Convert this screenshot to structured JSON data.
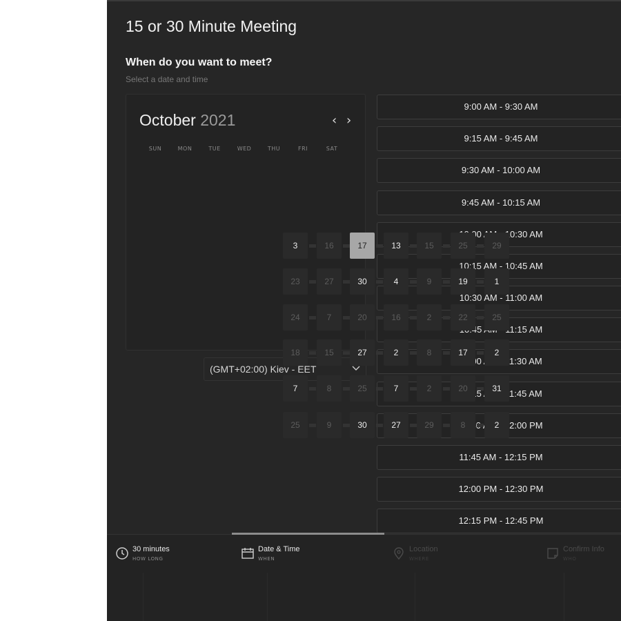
{
  "meeting": {
    "title": "15 or 30 Minute Meeting",
    "question": "When do you want to meet?",
    "hint": "Select a date and time"
  },
  "calendar": {
    "month": "October",
    "year": "2021",
    "prev_icon": "chevron-left-icon",
    "next_icon": "chevron-right-icon",
    "prev_glyph": "‹",
    "next_glyph": "›",
    "weekdays": [
      "SUN",
      "MON",
      "TUE",
      "WED",
      "THU",
      "FRI",
      "SAT"
    ],
    "selected_day": "17",
    "days": [
      "3",
      "16",
      "17",
      "13",
      "15",
      "25",
      "29",
      "23",
      "27",
      "30",
      "4",
      "9",
      "19",
      "1",
      "24",
      "7",
      "20",
      "16",
      "2",
      "22",
      "25",
      "18",
      "15",
      "27",
      "2",
      "8",
      "17",
      "2",
      "7",
      "8",
      "25",
      "7",
      "2",
      "20",
      "31",
      "25",
      "9",
      "30",
      "27",
      "29",
      "8",
      "2"
    ],
    "active_days": [
      "3",
      "17",
      "13",
      "30",
      "4",
      "19",
      "1",
      "2",
      "7",
      "27",
      "31"
    ]
  },
  "timezone": {
    "value": "(GMT+02:00) Kiev - EET",
    "chevron_icon": "chevron-down-icon"
  },
  "time_slots": [
    "9:00 AM - 9:30 AM",
    "9:15 AM - 9:45 AM",
    "9:30 AM - 10:00 AM",
    "9:45 AM - 10:15 AM",
    "10:00 AM - 10:30 AM",
    "10:15 AM - 10:45 AM",
    "10:30 AM - 11:00 AM",
    "10:45 AM - 11:15 AM",
    "11:00 AM - 11:30 AM",
    "11:15 AM - 11:45 AM",
    "11:30 AM - 12:00 PM",
    "11:45 AM - 12:15 PM",
    "12:00 PM - 12:30 PM",
    "12:15 PM - 12:45 PM"
  ],
  "steps": [
    {
      "label": "30 minutes",
      "sub": "HOW LONG",
      "icon": "clock-icon",
      "state": "done"
    },
    {
      "label": "Date & Time",
      "sub": "WHEN",
      "icon": "calendar-icon",
      "state": "active"
    },
    {
      "label": "Location",
      "sub": "WHERE",
      "icon": "location-pin-icon",
      "state": "upcoming"
    },
    {
      "label": "Confirm Info",
      "sub": "WHO",
      "icon": "note-icon",
      "state": "upcoming"
    }
  ],
  "colors": {
    "panel_bg": "#262626",
    "selected_day_bg": "#a7a7a7",
    "slot_border": "#3d3d3d",
    "active_step_line": "#8c8c8c"
  }
}
